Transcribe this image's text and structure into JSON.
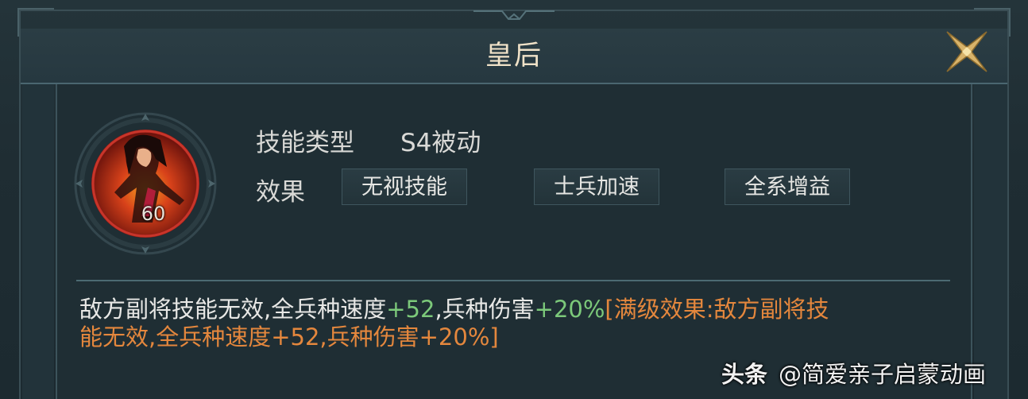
{
  "dialog": {
    "title": "皇后",
    "close_icon": "close-x-icon"
  },
  "skill": {
    "icon": "skill-portrait-icon",
    "level": "60",
    "type_label": "技能类型",
    "type_value": "S4被动",
    "effect_label": "效果",
    "effects": [
      "无视技能",
      "士兵加速",
      "全系增益"
    ]
  },
  "description": {
    "line1_a": "敌方副将技能无效,全兵种速度",
    "line1_b": "+52",
    "line1_c": ",兵种伤害",
    "line1_d": "+20%",
    "line1_e": "[满级效果:敌方副将技",
    "line2": "能无效,全兵种速度+52,兵种伤害+20%]"
  },
  "watermark": {
    "brand": "头条",
    "account": "@简爱亲子启蒙动画"
  },
  "colors": {
    "accent_green": "#7cc97a",
    "accent_orange": "#e4873d",
    "title_gold": "#f0e2c8"
  }
}
